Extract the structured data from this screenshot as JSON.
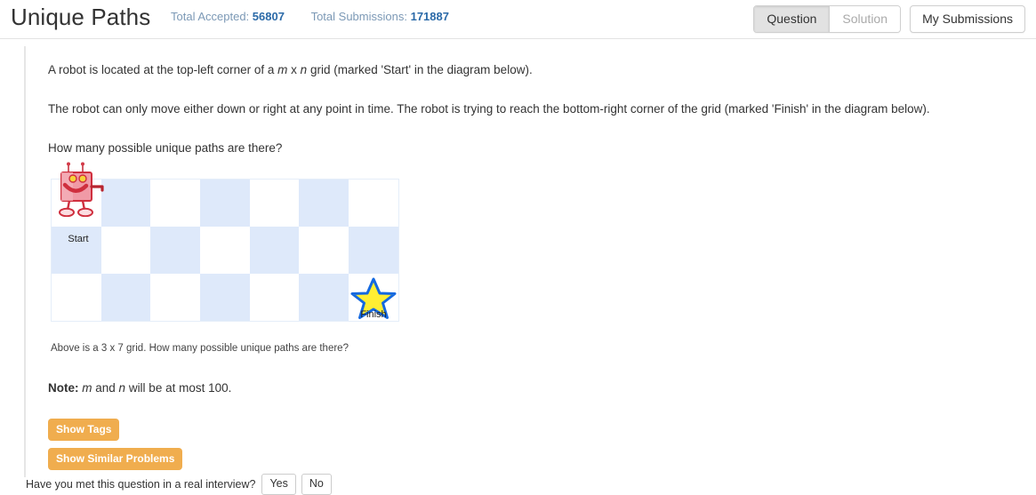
{
  "header": {
    "title": "Unique Paths",
    "stats": [
      {
        "label": "Total Accepted:",
        "value": "56807"
      },
      {
        "label": "Total Submissions:",
        "value": "171887"
      }
    ],
    "tabs": [
      {
        "label": "Question",
        "active": true
      },
      {
        "label": "Solution",
        "active": false
      }
    ],
    "my_submissions_label": "My Submissions"
  },
  "question": {
    "para1_a": "A robot is located at the top-left corner of a ",
    "para1_m": "m",
    "para1_x": " x ",
    "para1_n": "n",
    "para1_b": " grid (marked 'Start' in the diagram below).",
    "para2": "The robot can only move either down or right at any point in time. The robot is trying to reach the bottom-right corner of the grid (marked 'Finish' in the diagram below).",
    "para3": "How many possible unique paths are there?",
    "caption": "Above is a 3 x 7 grid. How many possible unique paths are there?",
    "note_label": "Note:",
    "note_m": "m",
    "note_and": " and ",
    "note_n": "n",
    "note_tail": " will be at most 100."
  },
  "diagram": {
    "rows": 3,
    "cols": 7,
    "start_label": "Start",
    "finish_label": "Finish",
    "cell_blue_color": "#dee9fa",
    "cell_white_color": "#ffffff",
    "robot_color": "#e8737f",
    "star_fill": "#ffee33",
    "star_stroke": "#1569e0"
  },
  "actions": {
    "show_tags": "Show Tags",
    "show_similar": "Show Similar Problems"
  },
  "footer": {
    "question": "Have you met this question in a real interview?",
    "yes": "Yes",
    "no": "No"
  }
}
